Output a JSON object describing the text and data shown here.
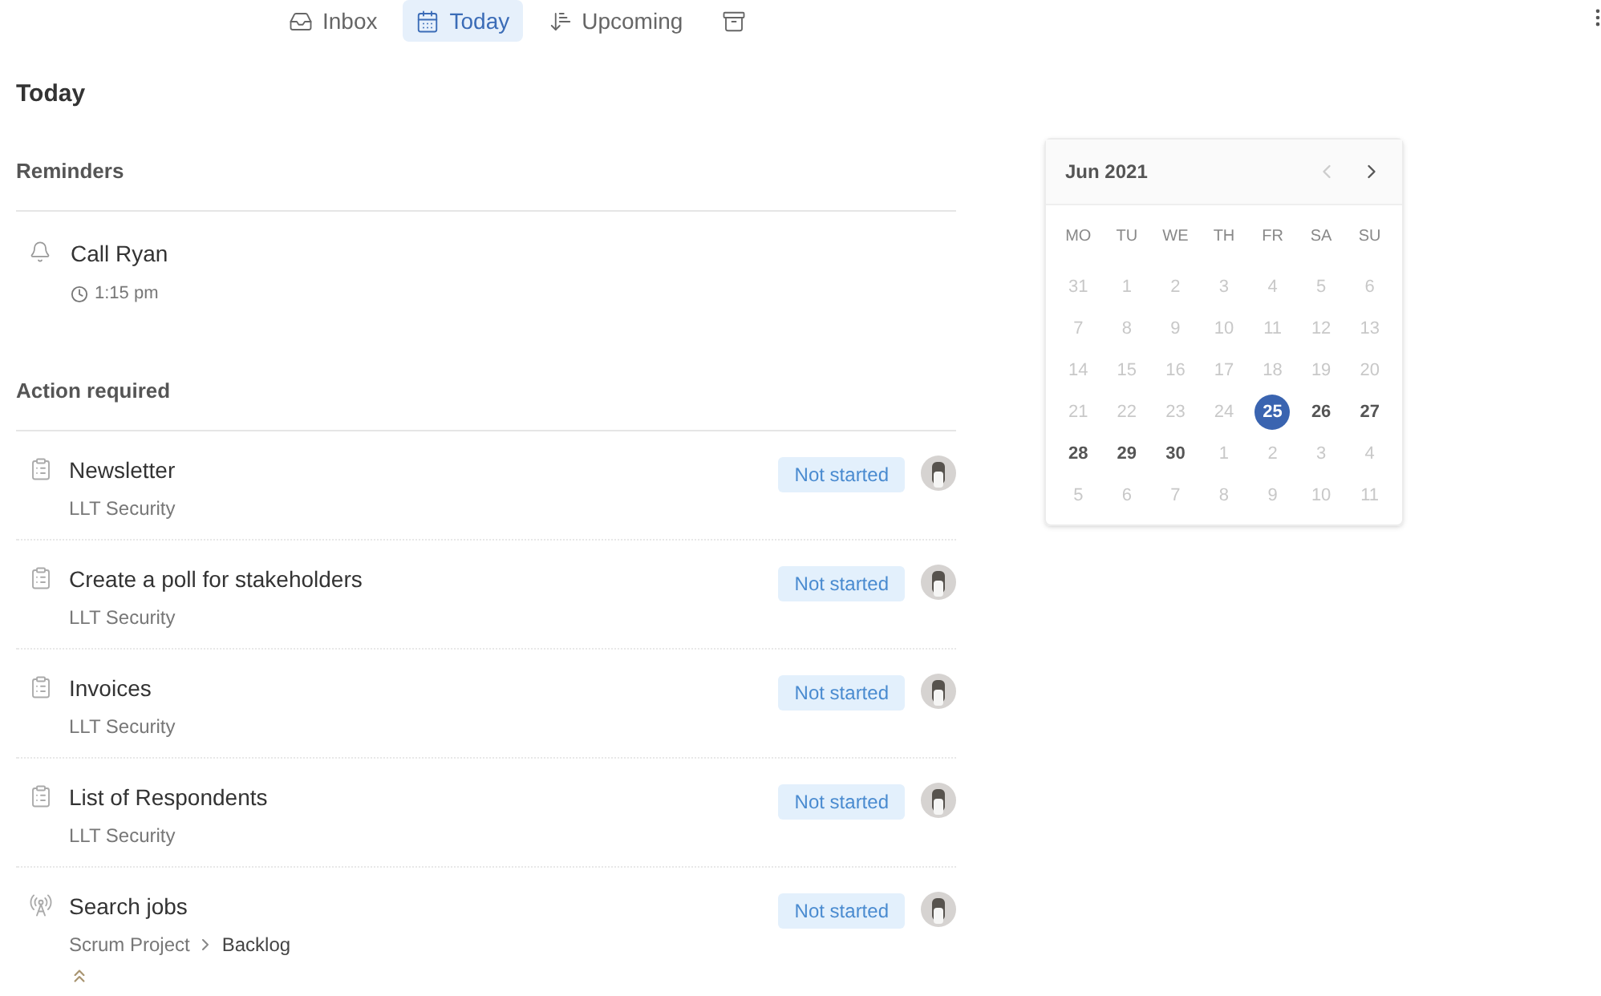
{
  "tabs": [
    {
      "kind": "inbox",
      "label": "Inbox",
      "selected": false
    },
    {
      "kind": "today",
      "label": "Today",
      "selected": true
    },
    {
      "kind": "upcoming",
      "label": "Upcoming",
      "selected": false
    },
    {
      "kind": "archive",
      "selected": false
    }
  ],
  "page_title": "Today",
  "reminders": {
    "heading": "Reminders",
    "items": [
      {
        "title": "Call Ryan",
        "time": "1:15 pm"
      }
    ]
  },
  "action_required": {
    "heading": "Action required",
    "items": [
      {
        "kind": "clipboard",
        "title": "Newsletter",
        "path": [
          "LLT Security"
        ],
        "status": "Not started"
      },
      {
        "kind": "clipboard",
        "title": "Create a poll for stakeholders",
        "path": [
          "LLT Security"
        ],
        "status": "Not started"
      },
      {
        "kind": "clipboard",
        "title": "Invoices",
        "path": [
          "LLT Security"
        ],
        "status": "Not started"
      },
      {
        "kind": "clipboard",
        "title": "List of Respondents",
        "path": [
          "LLT Security"
        ],
        "status": "Not started"
      },
      {
        "kind": "antenna",
        "title": "Search jobs",
        "path": [
          "Scrum Project",
          "Backlog"
        ],
        "status": "Not started",
        "high_priority": true
      }
    ]
  },
  "calendar": {
    "month": "Jun 2021",
    "weekdays": [
      "MO",
      "TU",
      "WE",
      "TH",
      "FR",
      "SA",
      "SU"
    ],
    "prev_disabled": true,
    "weeks": [
      [
        {
          "d": "31",
          "faded": true,
          "selected": false
        },
        {
          "d": "1",
          "faded": true,
          "selected": false
        },
        {
          "d": "2",
          "faded": true,
          "selected": false
        },
        {
          "d": "3",
          "faded": true,
          "selected": false
        },
        {
          "d": "4",
          "faded": true,
          "selected": false
        },
        {
          "d": "5",
          "faded": true,
          "selected": false
        },
        {
          "d": "6",
          "faded": true,
          "selected": false
        }
      ],
      [
        {
          "d": "7",
          "faded": true,
          "selected": false
        },
        {
          "d": "8",
          "faded": true,
          "selected": false
        },
        {
          "d": "9",
          "faded": true,
          "selected": false
        },
        {
          "d": "10",
          "faded": true,
          "selected": false
        },
        {
          "d": "11",
          "faded": true,
          "selected": false
        },
        {
          "d": "12",
          "faded": true,
          "selected": false
        },
        {
          "d": "13",
          "faded": true,
          "selected": false
        }
      ],
      [
        {
          "d": "14",
          "faded": true,
          "selected": false
        },
        {
          "d": "15",
          "faded": true,
          "selected": false
        },
        {
          "d": "16",
          "faded": true,
          "selected": false
        },
        {
          "d": "17",
          "faded": true,
          "selected": false
        },
        {
          "d": "18",
          "faded": true,
          "selected": false
        },
        {
          "d": "19",
          "faded": true,
          "selected": false
        },
        {
          "d": "20",
          "faded": true,
          "selected": false
        }
      ],
      [
        {
          "d": "21",
          "faded": true,
          "selected": false
        },
        {
          "d": "22",
          "faded": true,
          "selected": false
        },
        {
          "d": "23",
          "faded": true,
          "selected": false
        },
        {
          "d": "24",
          "faded": true,
          "selected": false
        },
        {
          "d": "25",
          "faded": false,
          "selected": true
        },
        {
          "d": "26",
          "faded": false,
          "selected": false
        },
        {
          "d": "27",
          "faded": false,
          "selected": false
        }
      ],
      [
        {
          "d": "28",
          "faded": false,
          "selected": false
        },
        {
          "d": "29",
          "faded": false,
          "selected": false
        },
        {
          "d": "30",
          "faded": false,
          "selected": false
        },
        {
          "d": "1",
          "faded": true,
          "selected": false
        },
        {
          "d": "2",
          "faded": true,
          "selected": false
        },
        {
          "d": "3",
          "faded": true,
          "selected": false
        },
        {
          "d": "4",
          "faded": true,
          "selected": false
        }
      ],
      [
        {
          "d": "5",
          "faded": true,
          "selected": false
        },
        {
          "d": "6",
          "faded": true,
          "selected": false
        },
        {
          "d": "7",
          "faded": true,
          "selected": false
        },
        {
          "d": "8",
          "faded": true,
          "selected": false
        },
        {
          "d": "9",
          "faded": true,
          "selected": false
        },
        {
          "d": "10",
          "faded": true,
          "selected": false
        },
        {
          "d": "11",
          "faded": true,
          "selected": false
        }
      ]
    ]
  }
}
